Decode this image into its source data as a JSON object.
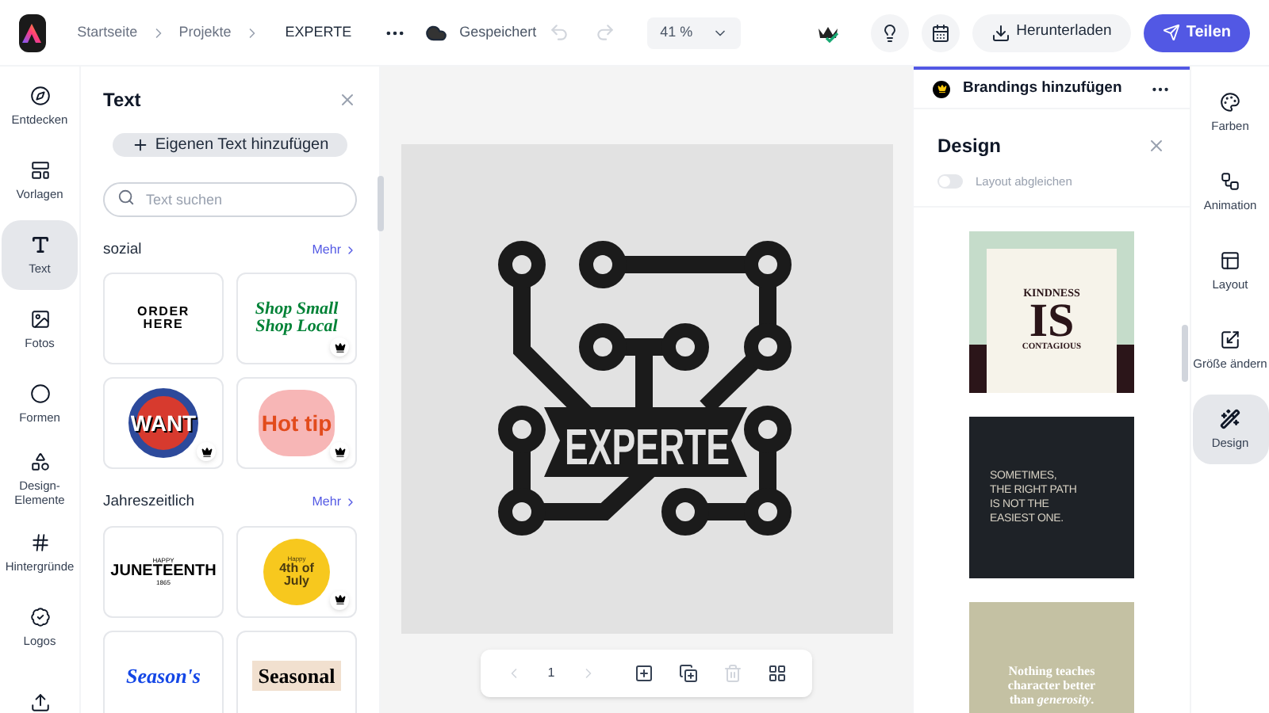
{
  "breadcrumb": [
    "Startseite",
    "Projekte"
  ],
  "project_title": "EXPERTE",
  "save_status": "Gespeichert",
  "zoom": "41 %",
  "buttons": {
    "download": "Herunterladen",
    "share": "Teilen"
  },
  "left_rail": [
    {
      "label": "Entdecken",
      "selected": false
    },
    {
      "label": "Vorlagen",
      "selected": false
    },
    {
      "label": "Text",
      "selected": true
    },
    {
      "label": "Fotos",
      "selected": false
    },
    {
      "label": "Formen",
      "selected": false
    },
    {
      "label": "Design-Elemente",
      "selected": false
    },
    {
      "label": "Hintergründe",
      "selected": false
    },
    {
      "label": "Logos",
      "selected": false
    },
    {
      "selected": false
    }
  ],
  "text_panel": {
    "title": "Text",
    "add_button": "Eigenen Text hinzufügen",
    "search": {
      "placeholder": "Text suchen"
    },
    "sections": [
      {
        "title": "sozial",
        "more": "Mehr",
        "items": [
          {
            "kind": "order",
            "lines": [
              "ORDER",
              "HERE"
            ],
            "premium": false
          },
          {
            "kind": "shop",
            "lines": [
              "Shop Small",
              "Shop Local"
            ],
            "premium": true
          },
          {
            "kind": "want",
            "lines": [
              "WANT"
            ],
            "premium": true
          },
          {
            "kind": "hottip",
            "lines": [
              "Hot tip"
            ],
            "premium": true
          }
        ]
      },
      {
        "title": "Jahreszeitlich",
        "more": "Mehr",
        "items": [
          {
            "kind": "juneteenth",
            "lines": [
              "HAPPY",
              "JUNETEENTH",
              "1865"
            ],
            "premium": false
          },
          {
            "kind": "july",
            "lines": [
              "Happy",
              "4th of",
              "July"
            ],
            "premium": true
          },
          {
            "kind": "seasons",
            "lines": [
              "Season's"
            ],
            "premium": false
          },
          {
            "kind": "seasonal",
            "lines": [
              "Seasonal"
            ],
            "premium": false
          }
        ]
      }
    ]
  },
  "canvas": {
    "logo_text": "EXPERTE",
    "page_number": "1"
  },
  "brand_bar": {
    "title": "Brandings hinzufügen"
  },
  "design_panel": {
    "title": "Design",
    "toggle": {
      "label": "Layout abgleichen",
      "on": false
    },
    "designs": [
      {
        "kind": "kindness",
        "lines": [
          "KINDNESS",
          "IS",
          "CONTAGIOUS"
        ]
      },
      {
        "kind": "sometimes",
        "lines": [
          "SOMETIMES,",
          "THE RIGHT PATH",
          "IS NOT THE",
          "EASIEST ONE."
        ]
      },
      {
        "kind": "nothing",
        "lines": [
          "Nothing teaches",
          "character better",
          "than *generosity*."
        ]
      }
    ]
  },
  "right_rail": [
    {
      "label": "Farben",
      "selected": false
    },
    {
      "label": "Animation",
      "selected": false
    },
    {
      "label": "Layout",
      "selected": false
    },
    {
      "label": "Größe ändern",
      "selected": false
    },
    {
      "label": "Design",
      "selected": true
    }
  ]
}
